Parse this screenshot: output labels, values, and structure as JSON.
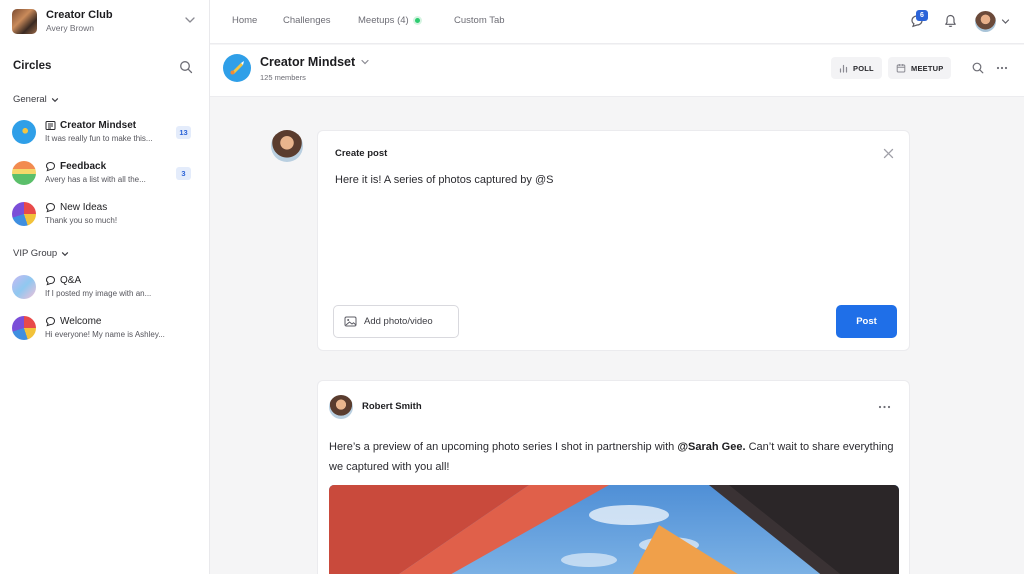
{
  "club": {
    "name": "Creator Club",
    "user": "Avery Brown"
  },
  "sidebar": {
    "heading": "Circles",
    "groups": [
      {
        "label": "General"
      },
      {
        "label": "VIP Group"
      }
    ],
    "spaces": [
      {
        "title": "Creator Mindset",
        "preview": "It was really fun to make this...",
        "badge": "13"
      },
      {
        "title": "Feedback",
        "preview": "Avery has a list with all the...",
        "badge": "3"
      },
      {
        "title": "New Ideas",
        "preview": "Thank you so much!",
        "badge": ""
      },
      {
        "title": "Q&A",
        "preview": "If I posted my image with an...",
        "badge": ""
      },
      {
        "title": "Welcome",
        "preview": "Hi everyone! My name is Ashley...",
        "badge": ""
      }
    ]
  },
  "topnav": {
    "items": [
      {
        "label": "Home"
      },
      {
        "label": "Challenges"
      },
      {
        "label": "Meetups (4)"
      },
      {
        "label": "Custom Tab"
      }
    ],
    "message_count": "6"
  },
  "circle": {
    "title": "Creator Mindset",
    "members": "125 members",
    "poll_label": "POLL",
    "meetup_label": "MEETUP"
  },
  "create_post": {
    "title": "Create post",
    "draft": "Here it is! A series of photos captured by @S",
    "photo_label": "Add photo/video",
    "post_label": "Post"
  },
  "post": {
    "author": "Robert Smith",
    "text_before": "Here’s a preview of an upcoming photo series I shot in partnership with ",
    "mention": "@Sarah Gee.",
    "text_after": " Can’t wait to share everything we captured with you all!"
  },
  "colors": {
    "accent": "#1f6fe8",
    "badge_bg": "#e4ecfb",
    "live": "#2ecc71"
  }
}
